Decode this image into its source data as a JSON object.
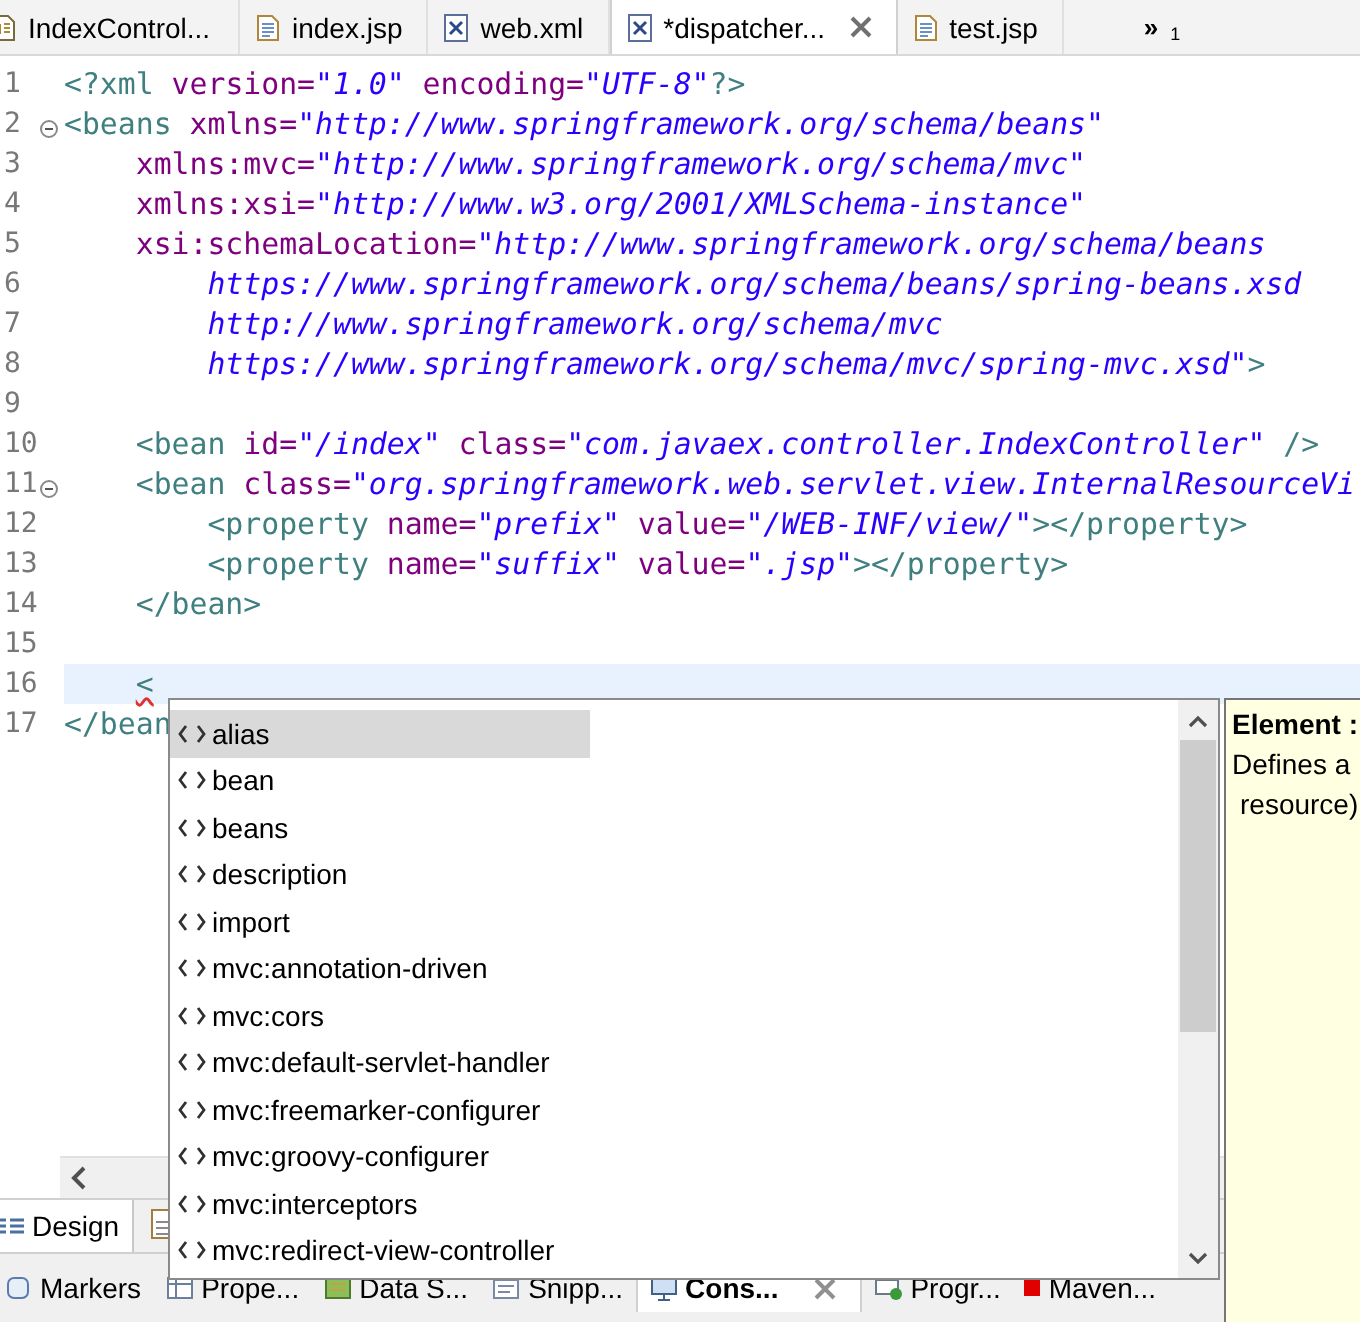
{
  "editor_tabs": [
    {
      "label": "IndexControl...",
      "kind": "java",
      "selected": false
    },
    {
      "label": "index.jsp",
      "kind": "jsp",
      "selected": false
    },
    {
      "label": "web.xml",
      "kind": "xml",
      "selected": false
    },
    {
      "label": "*dispatcher...",
      "kind": "xml",
      "selected": true
    },
    {
      "label": "test.jsp",
      "kind": "jsp",
      "selected": false
    }
  ],
  "overflow": {
    "label": "»",
    "count": "1"
  },
  "editor": {
    "lines": [
      {
        "number": "1",
        "tokens": [
          {
            "kind": "tag",
            "text": "<?xml"
          },
          {
            "kind": "attr",
            "text": " version="
          },
          {
            "kind": "value",
            "text": "\"1.0\""
          },
          {
            "kind": "attr",
            "text": " encoding="
          },
          {
            "kind": "value",
            "text": "\"UTF-8\""
          },
          {
            "kind": "tag",
            "text": "?>"
          }
        ]
      },
      {
        "number": "2",
        "foldable": true,
        "tokens": [
          {
            "kind": "tag",
            "text": "<beans"
          },
          {
            "kind": "attr",
            "text": " xmlns="
          },
          {
            "kind": "value",
            "text": "\"http://www.springframework.org/schema/beans\""
          }
        ]
      },
      {
        "number": "3",
        "tokens": [
          {
            "kind": "attr",
            "text": "    xmlns:mvc="
          },
          {
            "kind": "value",
            "text": "\"http://www.springframework.org/schema/mvc\""
          }
        ]
      },
      {
        "number": "4",
        "tokens": [
          {
            "kind": "attr",
            "text": "    xmlns:xsi="
          },
          {
            "kind": "value",
            "text": "\"http://www.w3.org/2001/XMLSchema-instance\""
          }
        ]
      },
      {
        "number": "5",
        "tokens": [
          {
            "kind": "attr",
            "text": "    xsi:schemaLocation="
          },
          {
            "kind": "value",
            "text": "\"http://www.springframework.org/schema/beans"
          }
        ]
      },
      {
        "number": "6",
        "tokens": [
          {
            "kind": "value",
            "text": "        https://www.springframework.org/schema/beans/spring-beans.xsd"
          }
        ]
      },
      {
        "number": "7",
        "tokens": [
          {
            "kind": "value",
            "text": "        http://www.springframework.org/schema/mvc"
          }
        ]
      },
      {
        "number": "8",
        "tokens": [
          {
            "kind": "value",
            "text": "        https://www.springframework.org/schema/mvc/spring-mvc.xsd\""
          },
          {
            "kind": "tag",
            "text": ">"
          }
        ]
      },
      {
        "number": "9"
      },
      {
        "number": "10",
        "tokens": [
          {
            "kind": "tag",
            "text": "    <bean"
          },
          {
            "kind": "attr",
            "text": " id="
          },
          {
            "kind": "value",
            "text": "\"/index\""
          },
          {
            "kind": "attr",
            "text": " class="
          },
          {
            "kind": "value",
            "text": "\"com.javaex.controller.IndexController\""
          },
          {
            "kind": "tag",
            "text": " />"
          }
        ]
      },
      {
        "number": "11",
        "foldable": true,
        "tokens": [
          {
            "kind": "tag",
            "text": "    <bean"
          },
          {
            "kind": "attr",
            "text": " class="
          },
          {
            "kind": "value",
            "text": "\"org.springframework.web.servlet.view.InternalResourceVi"
          }
        ]
      },
      {
        "number": "12",
        "tokens": [
          {
            "kind": "tag",
            "text": "        <property"
          },
          {
            "kind": "attr",
            "text": " name="
          },
          {
            "kind": "value",
            "text": "\"prefix\""
          },
          {
            "kind": "attr",
            "text": " value="
          },
          {
            "kind": "value",
            "text": "\"/WEB-INF/view/\""
          },
          {
            "kind": "tag",
            "text": "></property>"
          }
        ]
      },
      {
        "number": "13",
        "tokens": [
          {
            "kind": "tag",
            "text": "        <property"
          },
          {
            "kind": "attr",
            "text": " name="
          },
          {
            "kind": "value",
            "text": "\"suffix\""
          },
          {
            "kind": "attr",
            "text": " value="
          },
          {
            "kind": "value",
            "text": "\".jsp\""
          },
          {
            "kind": "tag",
            "text": "></property>"
          }
        ]
      },
      {
        "number": "14",
        "tokens": [
          {
            "kind": "tag",
            "text": "    </bean>"
          }
        ]
      },
      {
        "number": "15"
      },
      {
        "number": "16",
        "current": true,
        "tokens": [
          {
            "kind": "tag",
            "text": "    <",
            "error": true
          }
        ]
      },
      {
        "number": "17",
        "tokens": [
          {
            "kind": "tag",
            "text": "</bean"
          }
        ]
      }
    ]
  },
  "completion": {
    "items": [
      {
        "label": "alias",
        "selected": true
      },
      {
        "label": "bean",
        "selected": false
      },
      {
        "label": "beans",
        "selected": false
      },
      {
        "label": "description",
        "selected": false
      },
      {
        "label": "import",
        "selected": false
      },
      {
        "label": "mvc:annotation-driven",
        "selected": false
      },
      {
        "label": "mvc:cors",
        "selected": false
      },
      {
        "label": "mvc:default-servlet-handler",
        "selected": false
      },
      {
        "label": "mvc:freemarker-configurer",
        "selected": false
      },
      {
        "label": "mvc:groovy-configurer",
        "selected": false
      },
      {
        "label": "mvc:interceptors",
        "selected": false
      },
      {
        "label": "mvc:redirect-view-controller",
        "selected": false
      }
    ]
  },
  "info": {
    "title": "Element :",
    "lines": [
      "Defines a",
      "resource)"
    ]
  },
  "design_tabs": [
    {
      "label": "Design",
      "selected": true
    }
  ],
  "panel_tabs": [
    {
      "label": "Markers",
      "kind": "markers",
      "selected": false
    },
    {
      "label": "Prope...",
      "kind": "properties",
      "selected": false
    },
    {
      "label": "Data S...",
      "kind": "data",
      "selected": false
    },
    {
      "label": "Snipp...",
      "kind": "snippets",
      "selected": false
    },
    {
      "label": "Cons...",
      "kind": "console",
      "selected": true
    },
    {
      "label": "Progr...",
      "kind": "progress",
      "selected": false
    },
    {
      "label": "Maven...",
      "kind": "maven",
      "selected": false
    }
  ]
}
